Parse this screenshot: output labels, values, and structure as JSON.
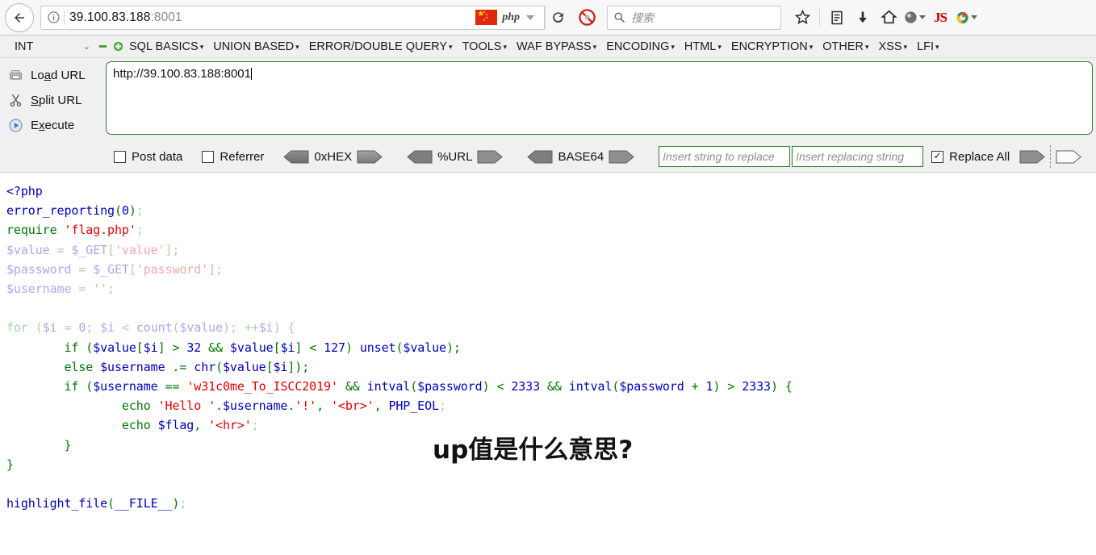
{
  "browser": {
    "back_icon": "back-arrow-icon",
    "info_icon": "info-icon",
    "url": "39.100.83.188",
    "url_port": ":8001",
    "flag_icon": "china-flag-icon",
    "php_label": "php",
    "reload_glyph": "⟳",
    "noscript_icon": "noscript-icon",
    "search_placeholder": "搜索",
    "search_icon": "search-icon",
    "icons": [
      {
        "name": "bookmark-star-icon",
        "glyph": "☆"
      },
      {
        "name": "library-icon",
        "glyph": "▤"
      },
      {
        "name": "downloads-icon",
        "glyph": "⬇"
      },
      {
        "name": "home-icon",
        "glyph": "⌂"
      },
      {
        "name": "account-icon",
        "glyph": "●"
      },
      {
        "name": "javascript-toggle-icon",
        "glyph": "JS"
      },
      {
        "name": "extension-icon",
        "glyph": "◕"
      }
    ]
  },
  "hackbar": {
    "type_select_value": "INT",
    "type_select_caret": "⌄",
    "minus_button": "▬",
    "plus_button": "✚",
    "menus": [
      "SQL BASICS",
      "UNION BASED",
      "ERROR/DOUBLE QUERY",
      "TOOLS",
      "WAF BYPASS",
      "ENCODING",
      "HTML",
      "ENCRYPTION",
      "OTHER",
      "XSS",
      "LFI"
    ],
    "menu_caret": "▾",
    "actions": [
      {
        "icon": "load-url-icon",
        "label_pre": "Lo",
        "label_key": "a",
        "label_post": "d URL"
      },
      {
        "icon": "split-url-icon",
        "label_pre": "",
        "label_key": "S",
        "label_post": "plit URL"
      },
      {
        "icon": "execute-icon",
        "label_pre": "E",
        "label_key": "x",
        "label_post": "ecute"
      }
    ],
    "url_value": "http://39.100.83.188:8001",
    "post_data_label": "Post data",
    "post_data_checked": false,
    "referrer_label": "Referrer",
    "referrer_checked": false,
    "encoders": [
      "0xHEX",
      "%URL",
      "BASE64"
    ],
    "replace_from_placeholder": "Insert string to replace",
    "replace_to_placeholder": "Insert replacing string",
    "replace_all_label": "Replace All",
    "replace_all_checked": true,
    "checkmark": "✓"
  },
  "page": {
    "overlay_text": "up值是什么意思?",
    "code_lines": [
      "<?php",
      "error_reporting(0);",
      "require 'flag.php';",
      "$value = $_GET['value'];",
      "$password = $_GET['password'];",
      "$username = '';",
      "",
      "for ($i = 0; $i < count($value); ++$i) {",
      "    if ($value[$i] > 32 && $value[$i] < 127) unset($value);",
      "    else $username .= chr($value[$i]);",
      "    if ($username == 'w31c0me_To_ISCC2019' && intval($password) < 2333 && intval($password + 1) > 2333) {",
      "        echo 'Hello '.$username.'!', '<br>', PHP_EOL;",
      "        echo $flag, '<hr>';",
      "    }",
      "}",
      "",
      "highlight_file(__FILE__);"
    ]
  },
  "colors": {
    "php_tag": "#0000BB",
    "php_keyword": "#007700",
    "php_string": "#DD0000",
    "php_default": "#0000BB",
    "hackbar_border": "#2f7d32",
    "flag_red": "#de2910",
    "accent_green": "#4aa93a"
  }
}
